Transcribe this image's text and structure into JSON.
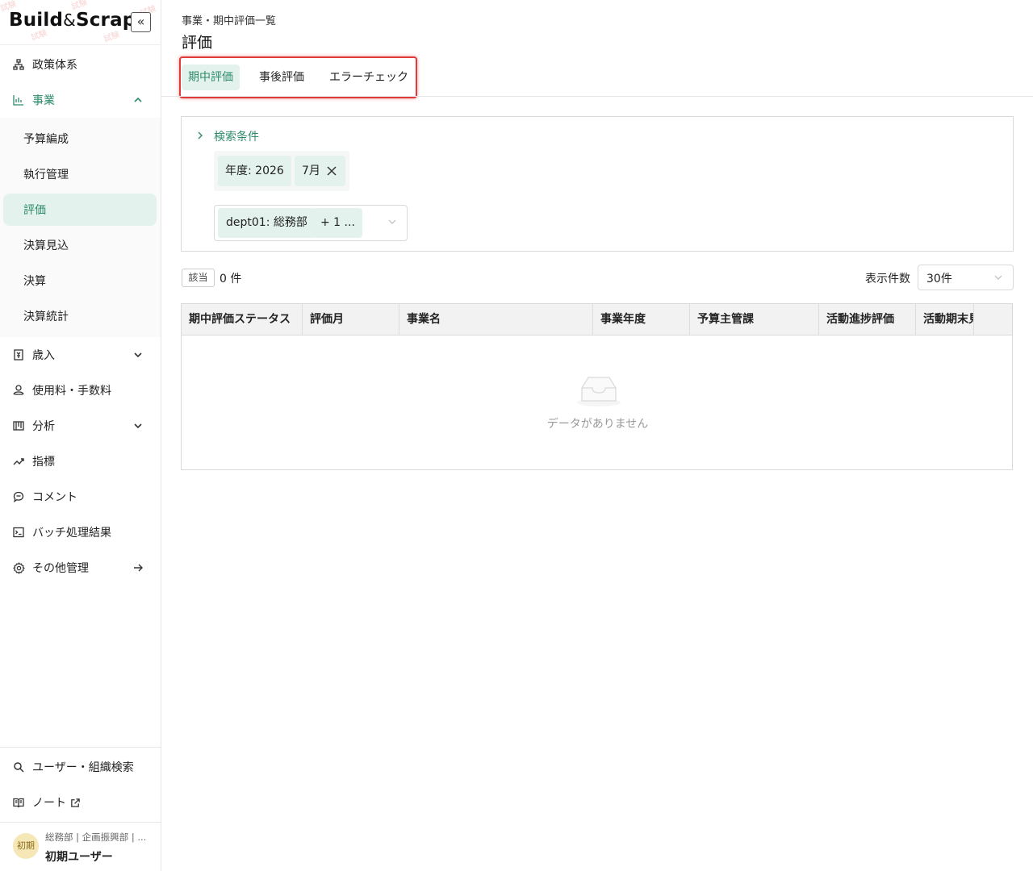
{
  "app": {
    "logo_main": "Build",
    "logo_amp": "&",
    "logo_tail": "Scrap"
  },
  "sidebar": {
    "collapse_glyph": "«",
    "items": [
      {
        "label": "政策体系",
        "icon": "org-chart-icon"
      },
      {
        "label": "事業",
        "icon": "bar-chart-icon"
      },
      {
        "label": "歳入",
        "icon": "revenue-icon"
      },
      {
        "label": "使用料・手数料",
        "icon": "fee-icon"
      },
      {
        "label": "分析",
        "icon": "analysis-icon"
      },
      {
        "label": "指標",
        "icon": "trend-icon"
      },
      {
        "label": "コメント",
        "icon": "comment-icon"
      },
      {
        "label": "バッチ処理結果",
        "icon": "terminal-icon"
      },
      {
        "label": "その他管理",
        "icon": "gear-icon"
      }
    ],
    "sub_items": [
      "予算編成",
      "執行管理",
      "評価",
      "決算見込",
      "決算",
      "決算統計"
    ],
    "bottom_items": [
      {
        "label": "ユーザー・組織検索",
        "icon": "search-icon"
      },
      {
        "label": "ノート",
        "icon": "book-icon"
      }
    ],
    "user": {
      "avatar": "初期",
      "org": "総務部 | 企画振興部 | ...",
      "name": "初期ユーザー"
    }
  },
  "header": {
    "breadcrumb": "事業・期中評価一覧",
    "title": "評価"
  },
  "tabs": [
    "期中評価",
    "事後評価",
    "エラーチェック"
  ],
  "search": {
    "toggle_label": "検索条件",
    "chips": [
      "年度: 2026",
      "7月"
    ],
    "dept_tag": "dept01: 総務部",
    "dept_more": "+ 1 ..."
  },
  "results": {
    "badge": "該当",
    "count": "0 件",
    "page_size_label": "表示件数",
    "page_size_value": "30件"
  },
  "table": {
    "columns": [
      "期中評価ステータス",
      "評価月",
      "事業名",
      "事業年度",
      "予算主管課",
      "活動進捗評価",
      "活動期末見込"
    ],
    "empty_text": "データがありません"
  },
  "colors": {
    "accent": "#2e8b6a",
    "highlight": "#e03a3a",
    "chip_bg": "#e3f2ec"
  }
}
